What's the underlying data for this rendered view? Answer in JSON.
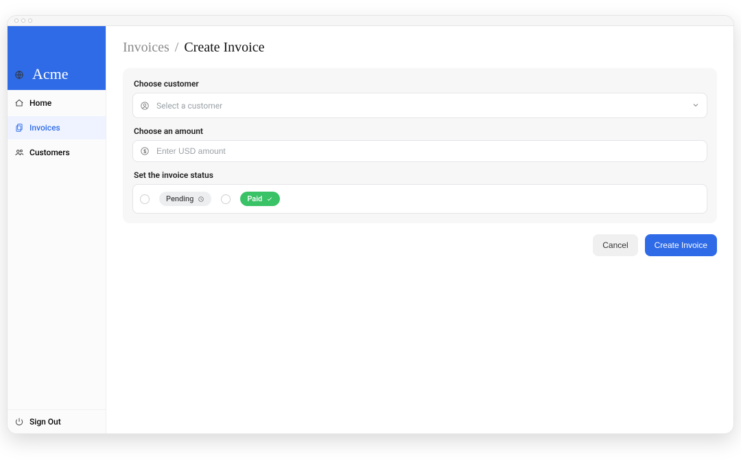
{
  "brand": {
    "name": "Acme"
  },
  "sidebar": {
    "items": [
      {
        "label": "Home",
        "icon": "home-icon",
        "active": false
      },
      {
        "label": "Invoices",
        "icon": "invoices-icon",
        "active": true
      },
      {
        "label": "Customers",
        "icon": "customers-icon",
        "active": false
      }
    ],
    "signout_label": "Sign Out"
  },
  "breadcrumb": {
    "parent": "Invoices",
    "separator": "/",
    "current": "Create Invoice"
  },
  "form": {
    "customer": {
      "label": "Choose customer",
      "placeholder": "Select a customer",
      "value": ""
    },
    "amount": {
      "label": "Choose an amount",
      "placeholder": "Enter USD amount",
      "value": ""
    },
    "status": {
      "label": "Set the invoice status",
      "options": [
        {
          "key": "pending",
          "label": "Pending"
        },
        {
          "key": "paid",
          "label": "Paid"
        }
      ],
      "selected": ""
    }
  },
  "actions": {
    "cancel_label": "Cancel",
    "submit_label": "Create Invoice"
  },
  "colors": {
    "primary": "#2f6be6",
    "success": "#3ac267",
    "panel_bg": "#f7f7f8",
    "border": "#e4e4e7"
  }
}
